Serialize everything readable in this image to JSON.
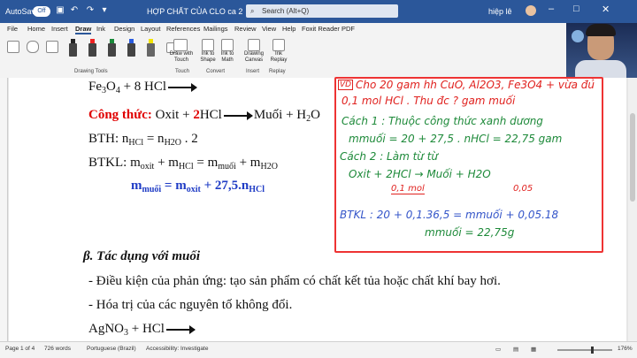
{
  "titlebar": {
    "autosave_label": "AutoSave",
    "autosave_state": "Off",
    "doc_title": "HỢP CHẤT CỦA CLO ca 2",
    "search_placeholder": "Search (Alt+Q)",
    "user_name": "hiệp lê"
  },
  "menu": [
    "File",
    "Home",
    "Insert",
    "Draw",
    "Ink",
    "Design",
    "Layout",
    "References",
    "Mailings",
    "Review",
    "View",
    "Help",
    "Foxit Reader PDF"
  ],
  "menu_active": "Draw",
  "ribbon": {
    "draw_with_touch": "Draw with Touch",
    "ink_to_shape": "Ink to Shape",
    "ink_to_math": "Ink to Math",
    "drawing_canvas": "Drawing Canvas",
    "ink_replay": "Ink Replay",
    "group_drawing_tools": "Drawing Tools",
    "group_touch": "Touch",
    "group_convert": "Convert",
    "group_insert": "Insert",
    "group_replay": "Replay"
  },
  "doc": {
    "l1_a": "Fe",
    "l1_b": "3",
    "l1_c": "O",
    "l1_d": "4",
    "l1_e": "+ 8 HCl",
    "l2_label": "Công thức:",
    "l2_a": "Oxit + ",
    "l2_b": "2",
    "l2_c": "HCl",
    "l2_d": "Muối + H",
    "l2_e": "2",
    "l2_f": "O",
    "l3": "BTH: n",
    "l3_s1": "HCl",
    "l3_m": " = n",
    "l3_s2": "H2O",
    "l3_e": " . 2",
    "l4": "BTKL: m",
    "l4_s1": "oxit",
    "l4_b": " + m",
    "l4_s2": "HCl",
    "l4_c": " = m",
    "l4_s3": "muối",
    "l4_d": " + m",
    "l4_s4": "H2O",
    "l5": "m",
    "l5_s1": "muối",
    "l5_b": " = m",
    "l5_s2": "oxit",
    "l5_c": " + 27,5.n",
    "l5_s3": "HCl",
    "section": "β. Tác dụng với muối",
    "cond": "- Điều kiện của phản ứng: tạo sản phẩm có chất kết tủa hoặc chất khí bay hơi.",
    "val": "- Hóa trị của các nguyên tố không đổi.",
    "last_a": "AgNO",
    "last_b": "3",
    "last_c": "  +      HCl"
  },
  "ink": {
    "vd": "VD",
    "p1": "Cho 20 gam hh CuO, Al2O3, Fe3O4 + vừa đủ",
    "p2": "0,1 mol HCl . Thu đc ? gam muối",
    "c1": "Cách 1 : Thuộc công thức xanh dương",
    "c1b": "mmuối = 20 + 27,5 . nHCl = 22,75 gam",
    "c2": "Cách 2 : Làm từ từ",
    "eq": "Oxit + 2HCl  →  Muối + H2O",
    "mol1": "0,1 mol",
    "mol2": "0,05",
    "btkl": "BTKL : 20 + 0,1.36,5 = mmuối + 0,05.18",
    "res": "mmuối = 22,75g"
  },
  "status": {
    "page": "Page 1 of 4",
    "words": "726 words",
    "lang": "Portuguese (Brazil)",
    "access": "Accessibility: Investigate",
    "zoom": "176%"
  }
}
